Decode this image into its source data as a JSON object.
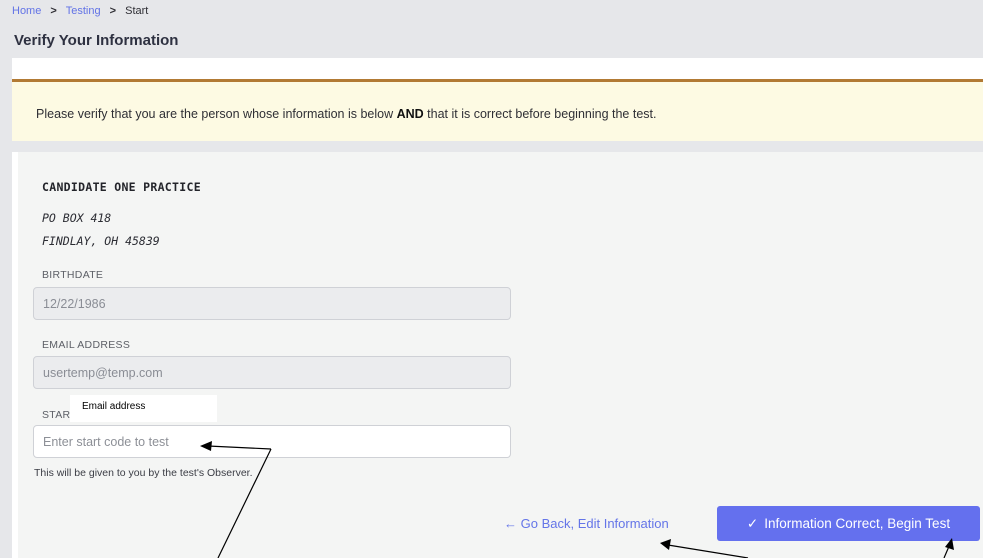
{
  "breadcrumb": {
    "items": [
      "Home",
      "Testing",
      "Start"
    ],
    "separator": ">"
  },
  "page_title": "Verify Your Information",
  "notice": {
    "before": "Please verify that you are the person whose information is below ",
    "emphasis": "AND",
    "after": " that it is correct before beginning the test."
  },
  "candidate": {
    "name": "CANDIDATE ONE PRACTICE",
    "address_line1": "PO BOX 418",
    "address_line2": "FINDLAY, OH 45839"
  },
  "fields": {
    "birthdate": {
      "label": "BIRTHDATE",
      "value": "12/22/1986"
    },
    "email": {
      "label": "EMAIL ADDRESS",
      "value": "usertemp@temp.com"
    },
    "start_code": {
      "label": "STAR",
      "placeholder": "Enter start code to test",
      "hint": "This will be given to you by the test's Observer."
    }
  },
  "overlay_note": "Email address",
  "actions": {
    "back": {
      "arrow": "←",
      "label": "Go Back, Edit Information"
    },
    "confirm": {
      "check": "✓",
      "label": "Information Correct, Begin Test"
    }
  },
  "colors": {
    "accent": "#6470ee",
    "link": "#6475e8",
    "notice_bg": "#fdfae3",
    "notice_border": "#b27a34"
  }
}
